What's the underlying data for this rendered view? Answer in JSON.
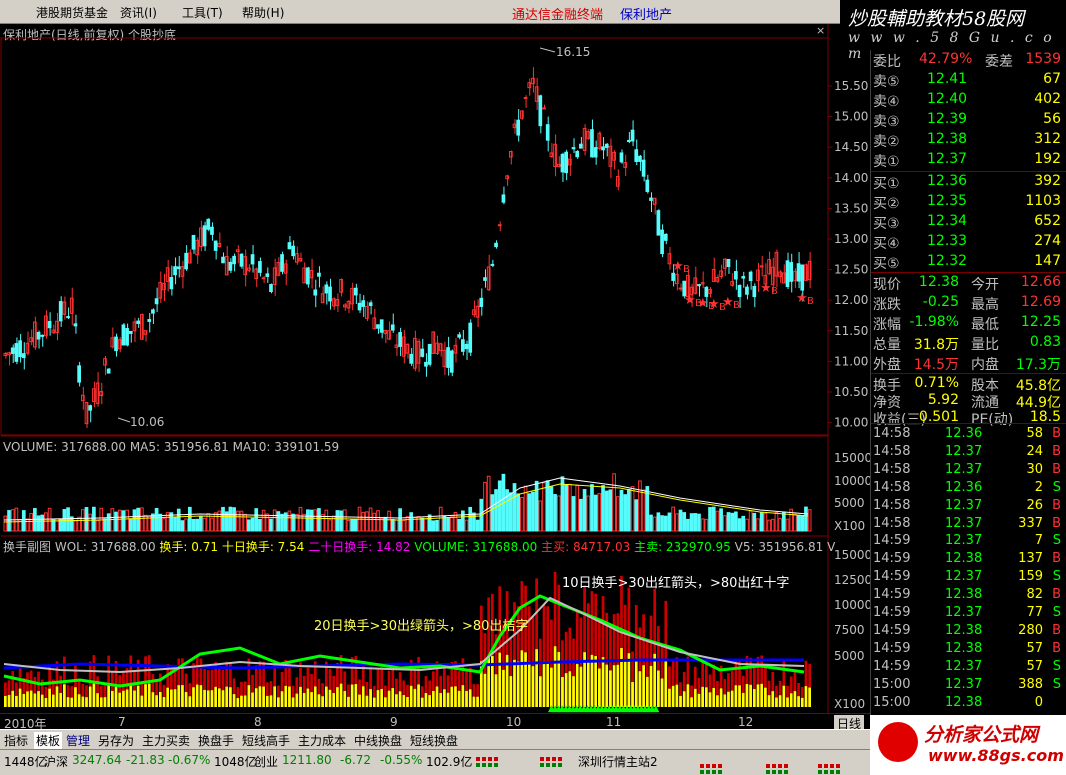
{
  "menu": {
    "items": [
      "港股期货基金",
      "资讯(I)",
      "工具(T)",
      "帮助(H)"
    ],
    "app_title": "通达信金融终端",
    "stock_name": "保利地产"
  },
  "watermark": {
    "line1": "炒股輔助教材58股网",
    "line2": "w w w . 5 8 G u . c o m"
  },
  "chart": {
    "title": "保利地产(日线,前复权) 个股抄底",
    "close_icon": "×",
    "high_label": "16.15",
    "low_label": "10.06",
    "price_axis": [
      "15.50",
      "15.00",
      "14.50",
      "14.00",
      "13.50",
      "13.00",
      "12.50",
      "12.00",
      "11.50",
      "11.00",
      "10.50",
      "10.00"
    ],
    "volume_line": "VOLUME: 317688.00  MA5: 351956.81  MA10: 339101.59",
    "volume_axis": [
      "15000",
      "10000",
      "5000",
      "X100"
    ],
    "sub_name": "换手副图",
    "sub_wol": "WOL: 317688.00",
    "sub_hs": "换手: 0.71",
    "sub_hs10": "十日换手: 7.54",
    "sub_hs20": "二十日换手: 14.82",
    "sub_vol": "VOLUME: 317688.00",
    "sub_buy": "主买: 84717.03",
    "sub_sell": "主卖: 232970.95",
    "sub_v5": "V5: 351956.81",
    "sub_v": "V",
    "sub_axis": [
      "15000",
      "12500",
      "10000",
      "7500",
      "5000",
      "X100"
    ],
    "note1": "10日换手>30出红箭头，>80出红十字",
    "note2": "20日换手>30出绿箭头，>80出桔字",
    "star_label": "B",
    "dates": [
      "2010年",
      "7",
      "8",
      "9",
      "10",
      "11",
      "12"
    ],
    "period": "日线"
  },
  "quote": {
    "top_row": {
      "l1": "委比",
      "v1": "42.79%",
      "l2": "委差",
      "v2": "1539"
    },
    "asks": [
      {
        "label": "卖⑤",
        "price": "12.41",
        "vol": "67"
      },
      {
        "label": "卖④",
        "price": "12.40",
        "vol": "402"
      },
      {
        "label": "卖③",
        "price": "12.39",
        "vol": "56"
      },
      {
        "label": "卖②",
        "price": "12.38",
        "vol": "312"
      },
      {
        "label": "卖①",
        "price": "12.37",
        "vol": "192"
      }
    ],
    "bids": [
      {
        "label": "买①",
        "price": "12.36",
        "vol": "392"
      },
      {
        "label": "买②",
        "price": "12.35",
        "vol": "1103"
      },
      {
        "label": "买③",
        "price": "12.34",
        "vol": "652"
      },
      {
        "label": "买④",
        "price": "12.33",
        "vol": "274"
      },
      {
        "label": "买⑤",
        "price": "12.32",
        "vol": "147"
      }
    ],
    "stats": [
      {
        "l1": "现价",
        "v1": "12.38",
        "l2": "今开",
        "v2": "12.66"
      },
      {
        "l1": "涨跌",
        "v1": "-0.25",
        "l2": "最高",
        "v2": "12.69"
      },
      {
        "l1": "涨幅",
        "v1": "-1.98%",
        "l2": "最低",
        "v2": "12.25"
      },
      {
        "l1": "总量",
        "v1": "31.8万",
        "l2": "量比",
        "v2": "0.83"
      },
      {
        "l1": "外盘",
        "v1": "14.5万",
        "l2": "内盘",
        "v2": "17.3万"
      }
    ],
    "fundamentals": [
      {
        "l1": "换手",
        "v1": "0.71%",
        "l2": "股本",
        "v2": "45.8亿"
      },
      {
        "l1": "净资",
        "v1": "5.92",
        "l2": "流通",
        "v2": "44.9亿"
      },
      {
        "l1": "收益(三)",
        "v1": "0.501",
        "l2": "PE(动)",
        "v2": "18.5"
      }
    ],
    "ticks": [
      {
        "time": "14:58",
        "price": "12.36",
        "vol": "58",
        "side": "B"
      },
      {
        "time": "14:58",
        "price": "12.37",
        "vol": "24",
        "side": "B"
      },
      {
        "time": "14:58",
        "price": "12.37",
        "vol": "30",
        "side": "B"
      },
      {
        "time": "14:58",
        "price": "12.36",
        "vol": "2",
        "side": "S"
      },
      {
        "time": "14:58",
        "price": "12.37",
        "vol": "26",
        "side": "B"
      },
      {
        "time": "14:58",
        "price": "12.37",
        "vol": "337",
        "side": "B"
      },
      {
        "time": "14:59",
        "price": "12.37",
        "vol": "7",
        "side": "S"
      },
      {
        "time": "14:59",
        "price": "12.38",
        "vol": "137",
        "side": "B"
      },
      {
        "time": "14:59",
        "price": "12.37",
        "vol": "159",
        "side": "S"
      },
      {
        "time": "14:59",
        "price": "12.38",
        "vol": "82",
        "side": "B"
      },
      {
        "time": "14:59",
        "price": "12.37",
        "vol": "77",
        "side": "S"
      },
      {
        "time": "14:59",
        "price": "12.38",
        "vol": "280",
        "side": "B"
      },
      {
        "time": "14:59",
        "price": "12.38",
        "vol": "57",
        "side": "B"
      },
      {
        "time": "14:59",
        "price": "12.37",
        "vol": "57",
        "side": "S"
      },
      {
        "time": "15:00",
        "price": "12.37",
        "vol": "388",
        "side": "S"
      },
      {
        "time": "15:00",
        "price": "12.38",
        "vol": "0",
        "side": ""
      }
    ]
  },
  "tabs": [
    "指标",
    "模板",
    "管理",
    "另存为",
    "主力买卖",
    "换盘手",
    "短线高手",
    "主力成本",
    "中线换盘",
    "短线换盘"
  ],
  "status": {
    "s1": "1448亿",
    "sh_name": "沪深",
    "sh_val": "3247.64",
    "sh_chg": "-21.83",
    "sh_pct": "-0.67%",
    "sh_amt": "1048亿",
    "cy_name": "创业",
    "cy_val": "1211.80",
    "cy_chg": "-6.72",
    "cy_pct": "-0.55%",
    "cy_amt": "102.9亿",
    "server": "深圳行情主站2"
  },
  "brand": {
    "line1": "分析家公式网",
    "line2": "www.88gs.com"
  },
  "colors": {
    "up": "#ff3232",
    "down": "#54fcfc",
    "yellow": "#ffff00",
    "green": "#00ff00",
    "blue": "#0000ff"
  }
}
